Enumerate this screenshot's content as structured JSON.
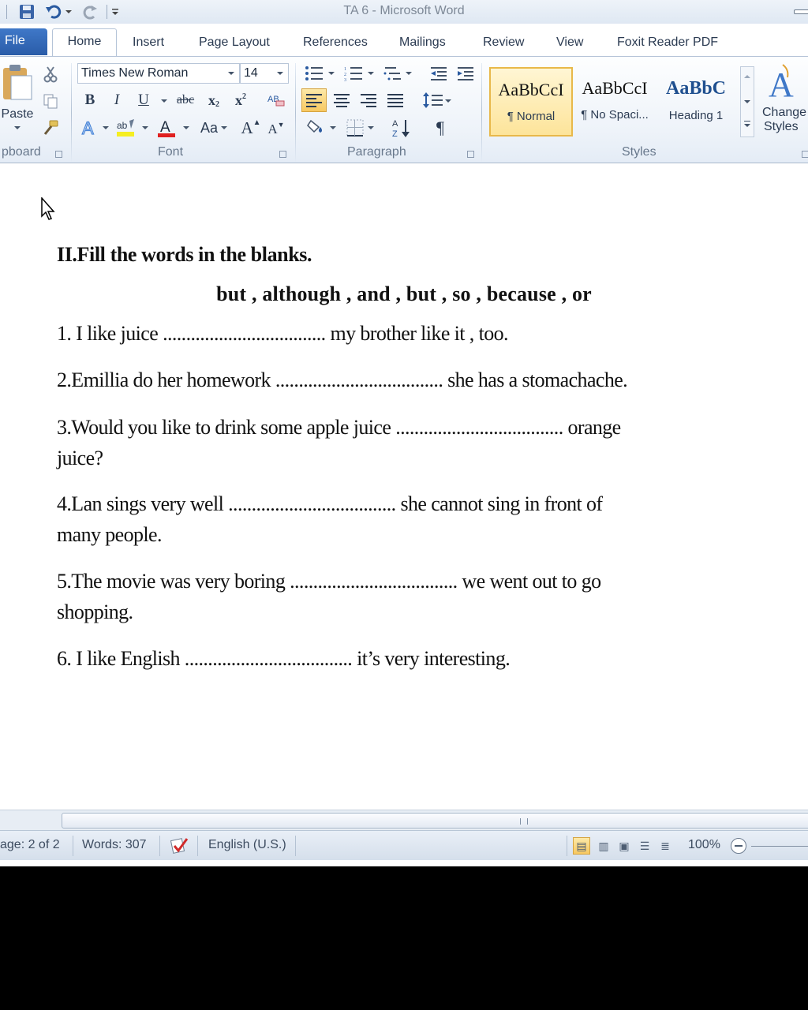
{
  "window": {
    "title": "TA 6  -  Microsoft Word"
  },
  "tabs": {
    "file": "File",
    "home": "Home",
    "insert": "Insert",
    "page_layout": "Page Layout",
    "references": "References",
    "mailings": "Mailings",
    "review": "Review",
    "view": "View",
    "foxit": "Foxit Reader PDF"
  },
  "ribbon": {
    "clipboard": {
      "label": "pboard",
      "paste": "Paste"
    },
    "font": {
      "label": "Font",
      "name": "Times New Roman",
      "size": "14",
      "bold": "B",
      "italic": "I",
      "underline": "U",
      "strike": "abc",
      "subscript": "x",
      "superscript": "x",
      "change_case": "Aa",
      "grow": "A",
      "shrink": "A"
    },
    "paragraph": {
      "label": "Paragraph",
      "pilcrow": "¶"
    },
    "styles": {
      "label": "Styles",
      "items": [
        {
          "sample": "AaBbCcI",
          "name": "¶ Normal"
        },
        {
          "sample": "AaBbCcI",
          "name": "¶ No Spaci..."
        },
        {
          "sample": "AaBbC",
          "name": "Heading 1"
        }
      ],
      "change_styles": [
        "Change",
        "Styles"
      ]
    },
    "accent": "#2a5ca8"
  },
  "document": {
    "heading": "II.Fill the words in the blanks.",
    "word_bank": "but , although , and , but , so , because , or",
    "lines": [
      "1. I like juice   ................................... my brother like it , too.",
      "2.Emillia do her homework   ....................................  she has a stomachache.",
      "3.Would you like to drink some apple juice  ....................................  orange",
      "juice?",
      "4.Lan sings very well    ....................................  she cannot sing in front of",
      "many people.",
      "5.The movie was very boring  .................................... we went out to go",
      "shopping.",
      "6. I like English  ....................................  it’s very interesting."
    ]
  },
  "status": {
    "page": "age: 2 of 2",
    "words": "Words: 307",
    "language": "English (U.S.)",
    "zoom": "100%"
  }
}
